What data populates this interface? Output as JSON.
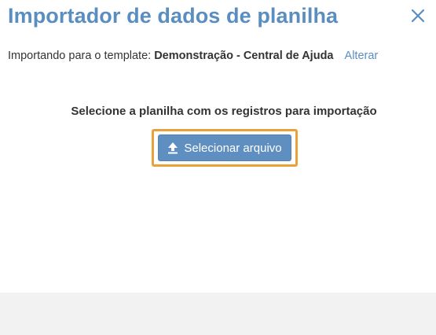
{
  "dialog": {
    "title": "Importador de dados de planilha",
    "close_icon": "close-icon"
  },
  "template": {
    "prefix": "Importando para o template:",
    "name": "Demonstração - Central de Ajuda",
    "change_label": "Alterar"
  },
  "upload": {
    "instruction": "Selecione a planilha com os registros para importação",
    "button_label": "Selecionar arquivo",
    "button_icon": "upload-icon"
  },
  "colors": {
    "title": "#5b8ec0",
    "link": "#5b8ec0",
    "button": "#5f8fc0",
    "highlight": "#e9a23a",
    "footer": "#f2f2f2"
  }
}
